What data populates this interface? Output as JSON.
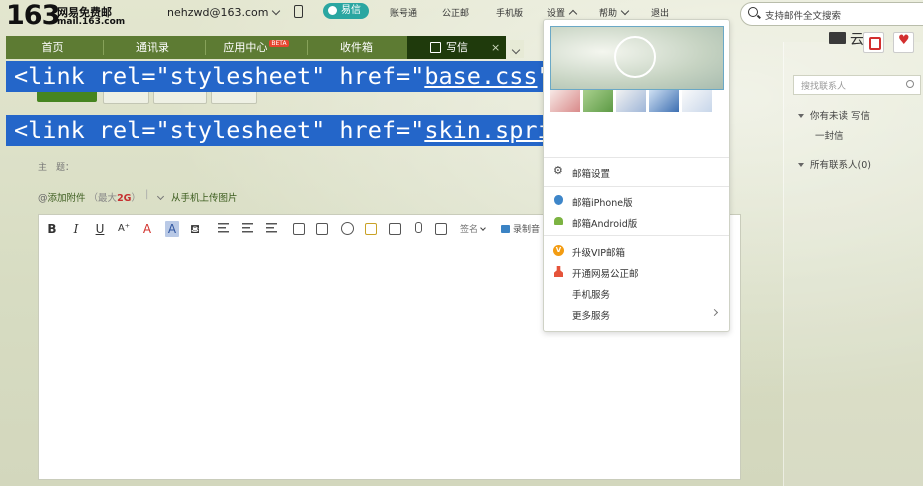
{
  "brand": {
    "number": "163",
    "title": "网易免费邮",
    "domain": "mail.163.com"
  },
  "top": {
    "user": "nehzwd@163.com",
    "yixin": "易信",
    "links": [
      "账号通",
      "公正邮",
      "手机版",
      "设置",
      "帮助",
      "退出"
    ],
    "search_placeholder": "支持邮件全文搜索"
  },
  "nav": {
    "tabs": [
      "首页",
      "通讯录",
      "应用中心",
      "收件箱"
    ],
    "beta": "BETA",
    "active_tab": "写信",
    "close": "×"
  },
  "overlay": {
    "line1_prefix": "<link rel=\"stylesheet\" href=\"",
    "line1_file": "base.css",
    "line1_suffix": "\">",
    "line2_prefix": "<link rel=\"stylesheet\" href=\"",
    "line2_file": "skin.spring.css",
    "line2_suffix": "\">"
  },
  "compose": {
    "subject_label": "主　题：",
    "attach_label": "添加附件",
    "attach_max_prefix": "（最大",
    "attach_max_value": "2G",
    "attach_max_suffix": "）",
    "upload_label": "从手机上传图片",
    "toolbar": {
      "bold": "B",
      "italic": "I",
      "underline": "U",
      "font_size": "A⁺",
      "font_color": "A",
      "bg_color": "A",
      "signature": "签名",
      "record": "录制音"
    }
  },
  "settings_menu": {
    "items": [
      {
        "icon": "gear-icon",
        "label": "邮箱设置"
      },
      {
        "icon": "apple-icon",
        "label": "邮箱iPhone版"
      },
      {
        "icon": "android-icon",
        "label": "邮箱Android版"
      },
      {
        "icon": "vip-icon",
        "label": "升级VIP邮箱"
      },
      {
        "icon": "stamp-icon",
        "label": "开通网易公正邮"
      },
      {
        "icon": "",
        "label": "手机服务"
      },
      {
        "icon": "",
        "label": "更多服务"
      }
    ]
  },
  "right_panel": {
    "cloud_label": "云",
    "contact_search_placeholder": "搜找联系人",
    "recent_text": "你有未读 写信",
    "one_letter": "一封信",
    "all_contacts": "所有联系人(0)"
  },
  "colors": {
    "nav_green": "#5d7b33",
    "overlay_blue": "#2466c9",
    "active_tab": "#1f3a0c"
  }
}
